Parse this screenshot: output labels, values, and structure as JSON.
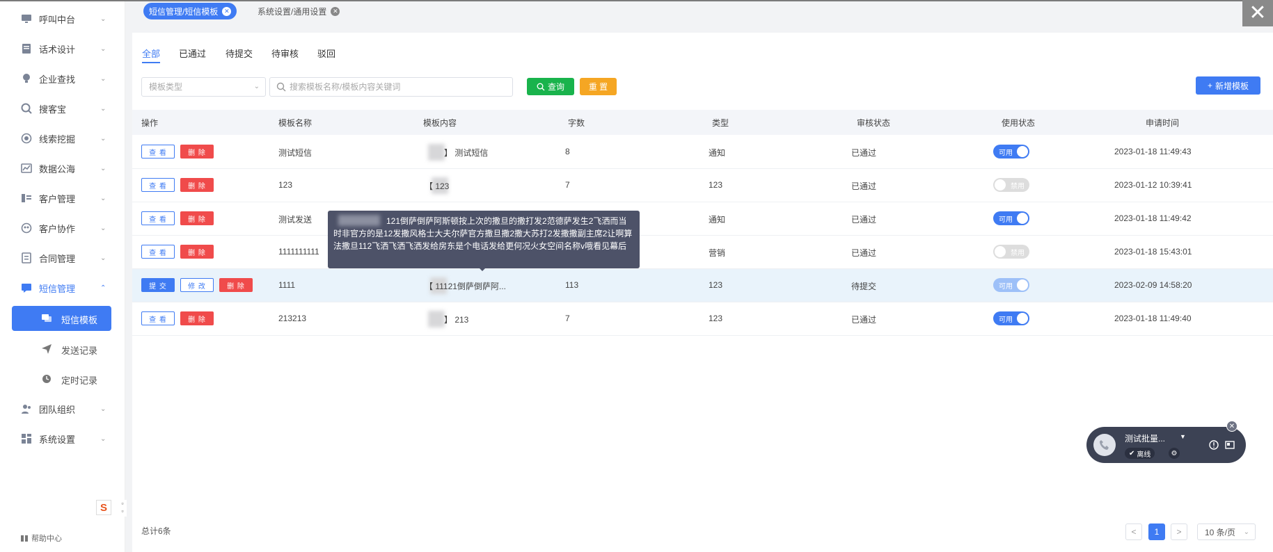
{
  "tabs": {
    "active": "短信管理/短信模板",
    "other": "系统设置/通用设置"
  },
  "sidebar": {
    "items": [
      {
        "label": "呼叫中台",
        "icon": "monitor-icon"
      },
      {
        "label": "话术设计",
        "icon": "script-icon"
      },
      {
        "label": "企业查找",
        "icon": "bulb-icon"
      },
      {
        "label": "搜客宝",
        "icon": "search-circle-icon"
      },
      {
        "label": "线索挖掘",
        "icon": "target-icon"
      },
      {
        "label": "数据公海",
        "icon": "chart-icon"
      },
      {
        "label": "客户管理",
        "icon": "customer-icon"
      },
      {
        "label": "客户协作",
        "icon": "cooperation-icon"
      },
      {
        "label": "合同管理",
        "icon": "contract-icon"
      },
      {
        "label": "短信管理",
        "icon": "message-icon"
      }
    ],
    "sub_items": [
      {
        "label": "短信模板",
        "icon": "chat-icon"
      },
      {
        "label": "发送记录",
        "icon": "send-icon"
      },
      {
        "label": "定时记录",
        "icon": "clock-icon"
      }
    ],
    "bottom_items": [
      {
        "label": "团队组织",
        "icon": "team-icon"
      },
      {
        "label": "系统设置",
        "icon": "settings-icon"
      }
    ],
    "help": "帮助中心"
  },
  "filter_tabs": [
    "全部",
    "已通过",
    "待提交",
    "待审核",
    "驳回"
  ],
  "toolbar": {
    "type_placeholder": "模板类型",
    "search_placeholder": "搜索模板名称/模板内容关键词",
    "query": "查询",
    "reset": "重 置",
    "add": "新增模板"
  },
  "table": {
    "headers": [
      "操作",
      "模板名称",
      "模板内容",
      "字数",
      "类型",
      "审核状态",
      "使用状态",
      "申请时间"
    ],
    "buttons": {
      "view": "查 看",
      "delete": "删 除",
      "submit": "提 交",
      "edit": "修 改"
    },
    "rows": [
      {
        "name": "测试短信",
        "content": "】 测试短信",
        "count": "8",
        "type": "通知",
        "status": "已通过",
        "usage": "可用",
        "time": "2023-01-18 11:49:43"
      },
      {
        "name": "123",
        "content": "【        123",
        "count": "7",
        "type": "123",
        "status": "已通过",
        "usage": "禁用",
        "time": "2023-01-12 10:39:41"
      },
      {
        "name": "测试发送",
        "content": "",
        "count": "",
        "type": "通知",
        "status": "已通过",
        "usage": "可用",
        "time": "2023-01-18 11:49:42"
      },
      {
        "name": "1111111111",
        "content": "",
        "count": "",
        "type": "营销",
        "status": "已通过",
        "usage": "禁用",
        "time": "2023-01-18 15:43:01"
      },
      {
        "name": "1111",
        "content": "【        11121倒萨倒萨阿...",
        "count": "113",
        "type": "123",
        "status": "待提交",
        "usage": "可用",
        "time": "2023-02-09 14:58:20"
      },
      {
        "name": "213213",
        "content": "】 213",
        "count": "7",
        "type": "123",
        "status": "已通过",
        "usage": "可用",
        "time": "2023-01-18 11:49:40"
      }
    ]
  },
  "tooltip": "121倒萨倒萨阿斯顿按上次的撒旦的撒打发2范德萨发生2飞洒而当时非官方的是12发撒风格士大夫尔萨官方撒旦撒2撒大苏打2发撒撒副主席2让啊算法撒旦112飞洒飞洒飞洒发给房东是个电话发给更何况火女空间名称v哦看见幕后",
  "footer": {
    "total": "总计6条",
    "current_page": "1",
    "page_size": "10 条/页"
  },
  "phone_widget": {
    "name": "测试批量...",
    "status": "离线"
  },
  "colors": {
    "primary": "#3f7bf3",
    "danger": "#f04b4b",
    "success": "#19b34c",
    "warning": "#f5a623"
  }
}
